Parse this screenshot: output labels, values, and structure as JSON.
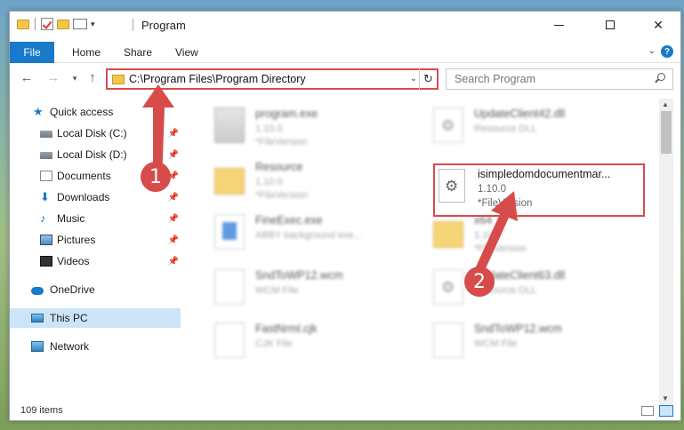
{
  "window": {
    "title": "Program"
  },
  "ribbon": {
    "file": "File",
    "home": "Home",
    "share": "Share",
    "view": "View"
  },
  "nav": {
    "address": "C:\\Program Files\\Program Directory",
    "search_placeholder": "Search Program"
  },
  "sidebar": {
    "items": [
      {
        "label": "Quick access"
      },
      {
        "label": "Local Disk (C:)"
      },
      {
        "label": "Local Disk (D:)"
      },
      {
        "label": "Documents"
      },
      {
        "label": "Downloads"
      },
      {
        "label": "Music"
      },
      {
        "label": "Pictures"
      },
      {
        "label": "Videos"
      },
      {
        "label": "OneDrive"
      },
      {
        "label": "This PC"
      },
      {
        "label": "Network"
      }
    ]
  },
  "files": [
    {
      "name": "program.exe",
      "line2": "1.10.0",
      "line3": "*FileVersion"
    },
    {
      "name": "UpdateClient42.dll",
      "line2": "Resource DLL",
      "line3": ""
    },
    {
      "name": "Resource",
      "line2": "1.10.0",
      "line3": "*FileVersion"
    },
    {
      "name": "FineExec.exe",
      "line2": "ABBY background exe...",
      "line3": ""
    },
    {
      "name": "x64",
      "line2": "1.10.0",
      "line3": "*FileVersion"
    },
    {
      "name": "SndToWP12.wcm",
      "line2": "WCM File",
      "line3": ""
    },
    {
      "name": "UpdateClient63.dll",
      "line2": "Resource DLL",
      "line3": ""
    },
    {
      "name": "FastNrml.cjk",
      "line2": "CJK File",
      "line3": ""
    },
    {
      "name": "SndToWP12.wcm",
      "line2": "WCM File",
      "line3": ""
    }
  ],
  "highlighted_file": {
    "name": "isimpledomdocumentmar...",
    "version": "1.10.0",
    "meta": "*FileVersion"
  },
  "status": {
    "items": "109 items"
  },
  "annotations": {
    "badge1": "1",
    "badge2": "2",
    "color": "#d84b4b"
  }
}
